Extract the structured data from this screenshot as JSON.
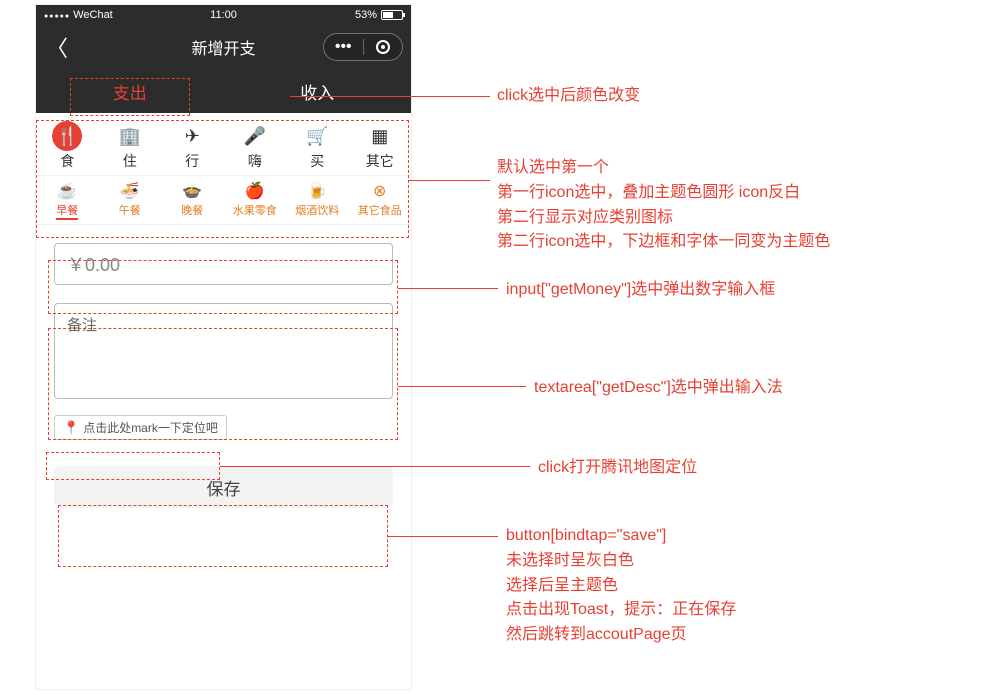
{
  "status": {
    "carrier": "WeChat",
    "time": "11:00",
    "battery_pct": "53%"
  },
  "nav": {
    "title": "新增开支"
  },
  "tabs": {
    "expense": "支出",
    "income": "收入"
  },
  "cat_row1": [
    {
      "icon": "🍴",
      "label": "食"
    },
    {
      "icon": "🏢",
      "label": "住"
    },
    {
      "icon": "✈",
      "label": "行"
    },
    {
      "icon": "🎤",
      "label": "嗨"
    },
    {
      "icon": "🛒",
      "label": "买"
    },
    {
      "icon": "▦",
      "label": "其它"
    }
  ],
  "cat_row2": [
    {
      "icon": "☕",
      "label": "早餐"
    },
    {
      "icon": "🍜",
      "label": "午餐"
    },
    {
      "icon": "🍲",
      "label": "晚餐"
    },
    {
      "icon": "🍎",
      "label": "水果零食"
    },
    {
      "icon": "🍺",
      "label": "烟酒饮料"
    },
    {
      "icon": "⊗",
      "label": "其它食品"
    }
  ],
  "form": {
    "money_placeholder": "￥0.00",
    "desc_placeholder": "备注",
    "location_hint": "点击此处mark一下定位吧",
    "save_label": "保存"
  },
  "annotations": {
    "a1": "click选中后颜色改变",
    "a2": "默认选中第一个\n第一行icon选中，叠加主题色圆形 icon反白\n第二行显示对应类别图标\n第二行icon选中，下边框和字体一同变为主题色",
    "a3": "input[\"getMoney\"]选中弹出数字输入框",
    "a4": "textarea[\"getDesc\"]选中弹出输入法",
    "a5": "click打开腾讯地图定位",
    "a6": "button[bindtap=\"save\"]\n未选择时呈灰白色\n选择后呈主题色\n点击出现Toast，提示：正在保存\n然后跳转到accoutPage页"
  }
}
